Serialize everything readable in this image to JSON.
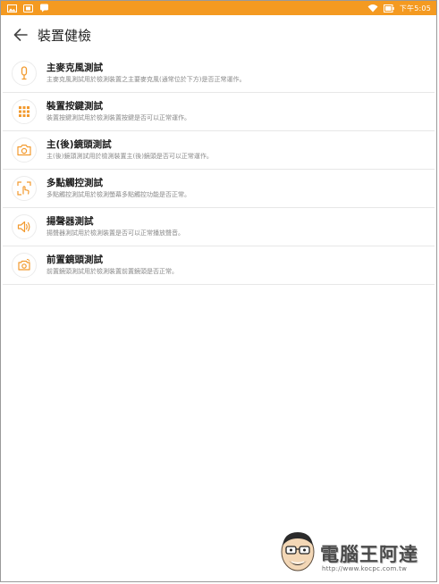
{
  "status_bar": {
    "time": "下午5:05",
    "left_icons": [
      "gallery-icon",
      "screenshot-icon",
      "chat-icon"
    ],
    "right_icons": [
      "wifi-icon",
      "battery-icon"
    ]
  },
  "app_bar": {
    "title": "裝置健檢"
  },
  "items": [
    {
      "title": "主麥克風測試",
      "desc": "主麥克風測試用於檢測裝置之主要麥克風(通常位於下方)是否正常運作。",
      "icon": "microphone-icon"
    },
    {
      "title": "裝置按鍵測試",
      "desc": "裝置按鍵測試用於檢測裝置按鍵是否可以正常運作。",
      "icon": "keypad-icon"
    },
    {
      "title": "主(後)鏡頭測試",
      "desc": "主(後)鏡頭測試用於檢測裝置主(後)鏡頭是否可以正常運作。",
      "icon": "camera-icon"
    },
    {
      "title": "多點觸控測試",
      "desc": "多點觸控測試用於檢測螢幕多點觸控功能是否正常。",
      "icon": "multitouch-icon"
    },
    {
      "title": "揚聲器測試",
      "desc": "揚聲器測試用於檢測裝置是否可以正常播放聲音。",
      "icon": "speaker-icon"
    },
    {
      "title": "前置鏡頭測試",
      "desc": "前置鏡頭測試用於檢測裝置前置鏡頭是否正常。",
      "icon": "front-camera-icon"
    }
  ],
  "watermark": {
    "brand": "電腦王阿達",
    "url": "http://www.kocpc.com.tw"
  },
  "colors": {
    "status_bar": "#f49a21",
    "accent": "#f29a2e",
    "divider": "#e7e7e7"
  }
}
